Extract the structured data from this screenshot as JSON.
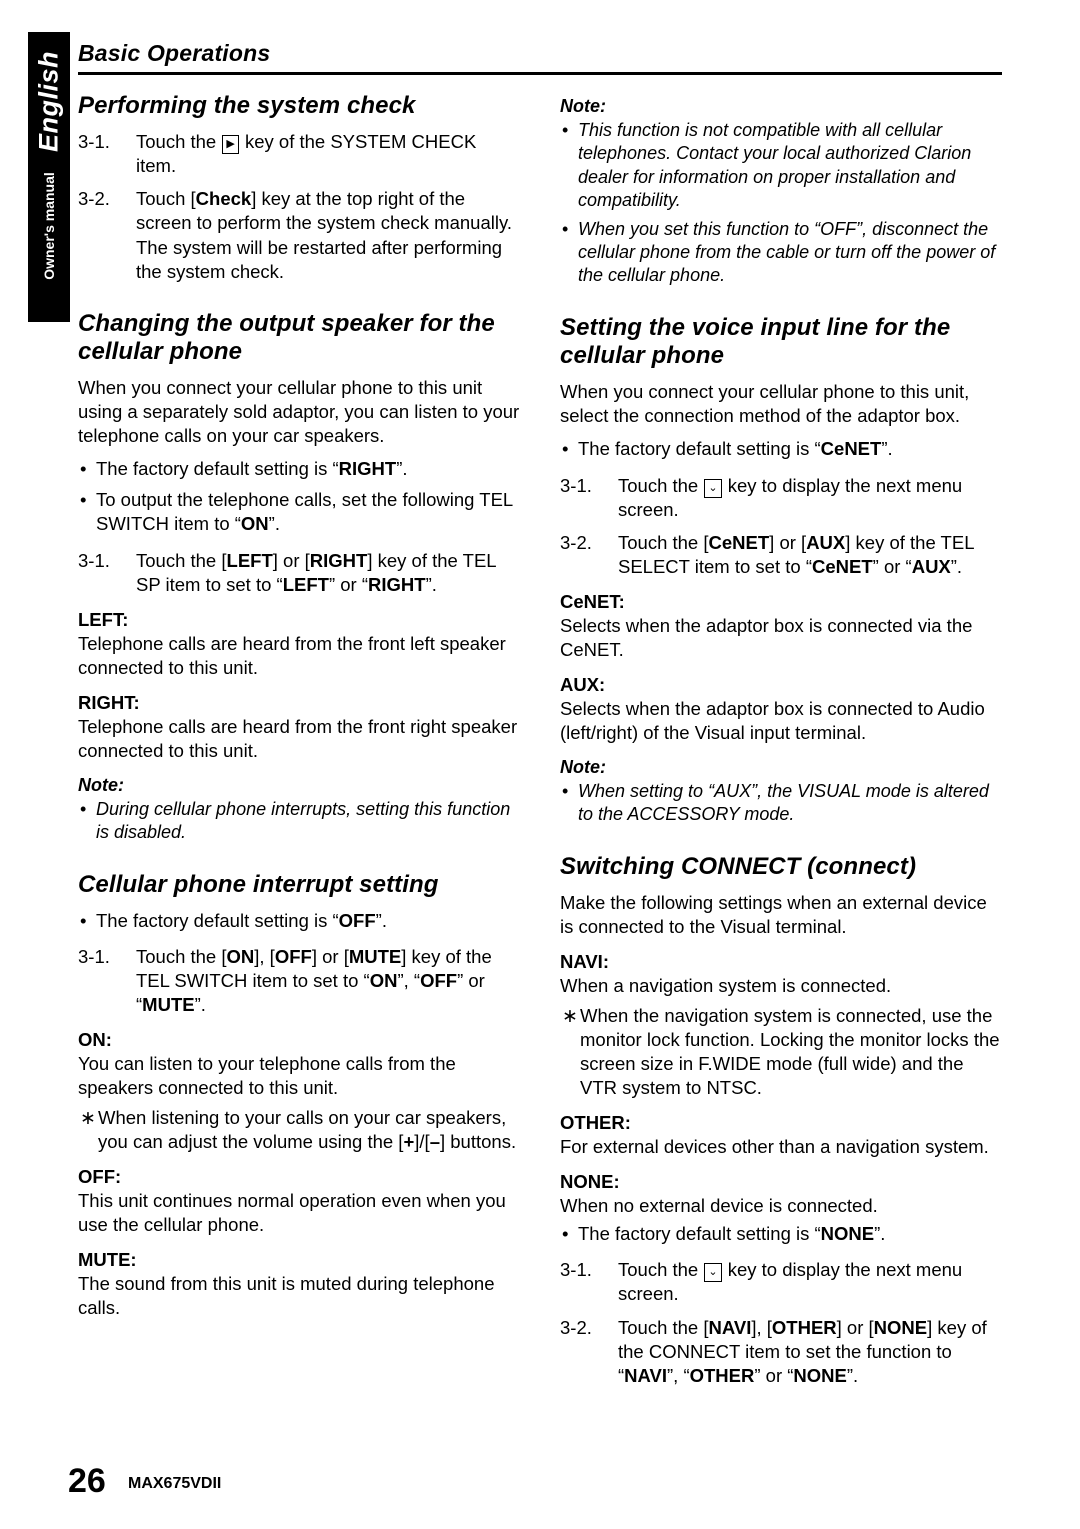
{
  "sidebar": {
    "language": "English",
    "manual_label": "Owner's manual"
  },
  "header": {
    "title": "Basic Operations"
  },
  "footer": {
    "page_number": "26",
    "model": "MAX675VDII"
  },
  "left_column": {
    "section1": {
      "heading": "Performing the system check",
      "steps": [
        {
          "num": "3-1.",
          "text_before": "Touch the ",
          "key_glyph": "▶",
          "text_after": " key of the SYSTEM CHECK item."
        },
        {
          "num": "3-2.",
          "text": "Touch [Check] key at the top right of the screen to perform the system check manually.",
          "text2": "The system will be restarted after performing the system check."
        }
      ]
    },
    "section2": {
      "heading": "Changing the output speaker for the cellular phone",
      "intro": "When you connect your cellular phone to this unit using a separately sold adaptor, you can listen to your telephone calls on your car speakers.",
      "bullets": [
        "The factory default setting is “RIGHT”.",
        "To output the telephone calls, set the following TEL SWITCH item to “ON”."
      ],
      "step": {
        "num": "3-1.",
        "text": "Touch the [LEFT] or [RIGHT] key of the TEL SP item to set to “LEFT” or “RIGHT”."
      },
      "terms": [
        {
          "label": "LEFT:",
          "desc": "Telephone calls are heard from the front left speaker connected to this unit."
        },
        {
          "label": "RIGHT:",
          "desc": "Telephone calls are heard from the front right speaker connected to this unit."
        }
      ],
      "note_label": "Note:",
      "notes": [
        "During cellular phone interrupts, setting this function is disabled."
      ]
    },
    "section3": {
      "heading": "Cellular phone interrupt setting",
      "bullets": [
        "The factory default setting is “OFF”."
      ],
      "step": {
        "num": "3-1.",
        "text": "Touch the [ON], [OFF] or [MUTE] key of the TEL SWITCH item to set to “ON”, “OFF” or “MUTE”."
      },
      "terms": [
        {
          "label": "ON:",
          "desc": "You can listen to your telephone calls from the speakers connected to this unit.",
          "star": "When listening to your calls on your car speakers, you can adjust the volume using the [+]/[–] buttons."
        },
        {
          "label": "OFF:",
          "desc": "This unit continues normal operation even when you use the cellular phone."
        },
        {
          "label": "MUTE:",
          "desc": "The sound from this unit is muted during telephone calls."
        }
      ]
    }
  },
  "right_column": {
    "note_top": {
      "label": "Note:",
      "items": [
        "This function is not compatible with all cellular telephones. Contact your local authorized Clarion dealer for information on proper installation and compatibility.",
        "When you set this function to “OFF”, disconnect the cellular phone from the cable or turn off the power of the cellular phone."
      ]
    },
    "section1": {
      "heading": "Setting the voice input line for the cellular phone",
      "intro": "When you connect your cellular phone to this unit, select the connection method of the adaptor box.",
      "bullets": [
        "The factory default setting is “CeNET”."
      ],
      "steps": [
        {
          "num": "3-1.",
          "text_before": "Touch the ",
          "key_glyph": "⌄",
          "text_after": " key to display the next menu screen."
        },
        {
          "num": "3-2.",
          "text": "Touch the [CeNET] or [AUX] key of the TEL SELECT item to set to “CeNET” or “AUX”."
        }
      ],
      "terms": [
        {
          "label": "CeNET:",
          "desc": "Selects when the adaptor box is connected via the CeNET."
        },
        {
          "label": "AUX:",
          "desc": "Selects when the adaptor box is connected to Audio (left/right) of the Visual input terminal."
        }
      ],
      "note_label": "Note:",
      "notes": [
        "When setting to “AUX”, the VISUAL mode is altered to the ACCESSORY mode."
      ]
    },
    "section2": {
      "heading": "Switching CONNECT (connect)",
      "intro": "Make the following settings when an external device is connected to the Visual terminal.",
      "terms": [
        {
          "label": "NAVI:",
          "desc": "When a navigation system is connected.",
          "star": "When the navigation system is connected, use the monitor lock function. Locking the monitor locks the screen size in F.WIDE mode (full wide) and the VTR system to NTSC."
        },
        {
          "label": "OTHER:",
          "desc": "For external devices other than a navigation system."
        },
        {
          "label": "NONE:",
          "desc": "When no external device is connected."
        }
      ],
      "bullets": [
        "The factory default setting is “NONE”."
      ],
      "steps": [
        {
          "num": "3-1.",
          "text_before": "Touch the ",
          "key_glyph": "⌄",
          "text_after": " key to display the next menu screen."
        },
        {
          "num": "3-2.",
          "text": "Touch the [NAVI], [OTHER] or [NONE] key of the CONNECT item to set the function to “NAVI”, “OTHER” or “NONE”."
        }
      ]
    }
  }
}
